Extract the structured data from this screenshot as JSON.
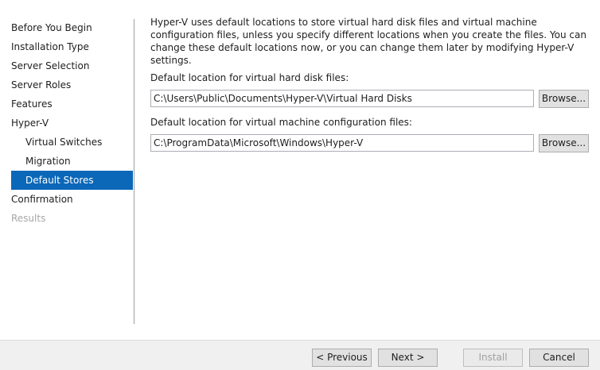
{
  "nav": {
    "items": [
      {
        "label": "Before You Begin"
      },
      {
        "label": "Installation Type"
      },
      {
        "label": "Server Selection"
      },
      {
        "label": "Server Roles"
      },
      {
        "label": "Features"
      },
      {
        "label": "Hyper-V"
      },
      {
        "label": "Virtual Switches"
      },
      {
        "label": "Migration"
      },
      {
        "label": "Default Stores"
      },
      {
        "label": "Confirmation"
      },
      {
        "label": "Results"
      }
    ],
    "selected": "Default Stores"
  },
  "main": {
    "intro": "Hyper-V uses default locations to store virtual hard disk files and virtual machine configuration files, unless you specify different locations when you create the files. You can change these default locations now, or you can change them later by modifying Hyper-V settings.",
    "vhd_label": "Default location for virtual hard disk files:",
    "vhd_value": "C:\\Users\\Public\\Documents\\Hyper-V\\Virtual Hard Disks",
    "vm_label": "Default location for virtual machine configuration files:",
    "vm_value": "C:\\ProgramData\\Microsoft\\Windows\\Hyper-V",
    "browse_label": "Browse..."
  },
  "footer": {
    "previous_label": "< Previous",
    "next_label": "Next >",
    "install_label": "Install",
    "cancel_label": "Cancel"
  },
  "colors": {
    "selection": "#0b67b8",
    "footer_bg": "#f0f0f0",
    "disabled_text": "#a6a6a6"
  }
}
